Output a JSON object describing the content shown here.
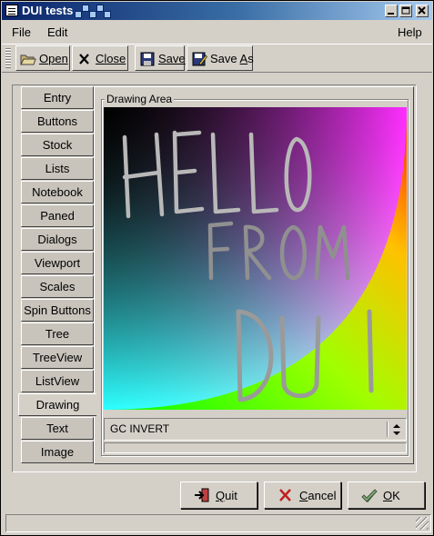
{
  "window": {
    "title": "DUI tests"
  },
  "menubar": {
    "file": "File",
    "edit": "Edit",
    "help": "Help"
  },
  "toolbar": {
    "open": {
      "label_ul": "O",
      "label_rest": "pen",
      "icon": "folder-open-icon"
    },
    "close": {
      "label_ul": "C",
      "label_rest": "lose",
      "icon": "close-x-icon"
    },
    "save": {
      "label_ul": "S",
      "label_rest": "ave",
      "icon": "floppy-disk-icon"
    },
    "save_as": {
      "label_pre": "Save ",
      "label_ul": "A",
      "label_rest": "s",
      "icon": "save-as-icon"
    }
  },
  "tabs": [
    "Entry",
    "Buttons",
    "Stock",
    "Lists",
    "Notebook",
    "Paned",
    "Dialogs",
    "Viewport",
    "Scales",
    "Spin Buttons",
    "Tree",
    "TreeView",
    "ListView",
    "Drawing",
    "Text",
    "Image"
  ],
  "active_tab": "Drawing",
  "drawing": {
    "group_label": "Drawing Area",
    "combo_value": "GC INVERT",
    "drawn_text": [
      "HELLO",
      "FROM",
      "DUI"
    ]
  },
  "buttons": {
    "quit": {
      "ul": "Q",
      "rest": "uit",
      "icon": "quit-icon"
    },
    "cancel": {
      "ul": "C",
      "rest": "ancel",
      "icon": "cancel-x-icon"
    },
    "ok": {
      "ul": "O",
      "rest": "K",
      "icon": "ok-check-icon"
    }
  },
  "colors": {
    "title_start": "#0a246a",
    "title_end": "#a6caf0",
    "face": "#d4d0c8"
  }
}
